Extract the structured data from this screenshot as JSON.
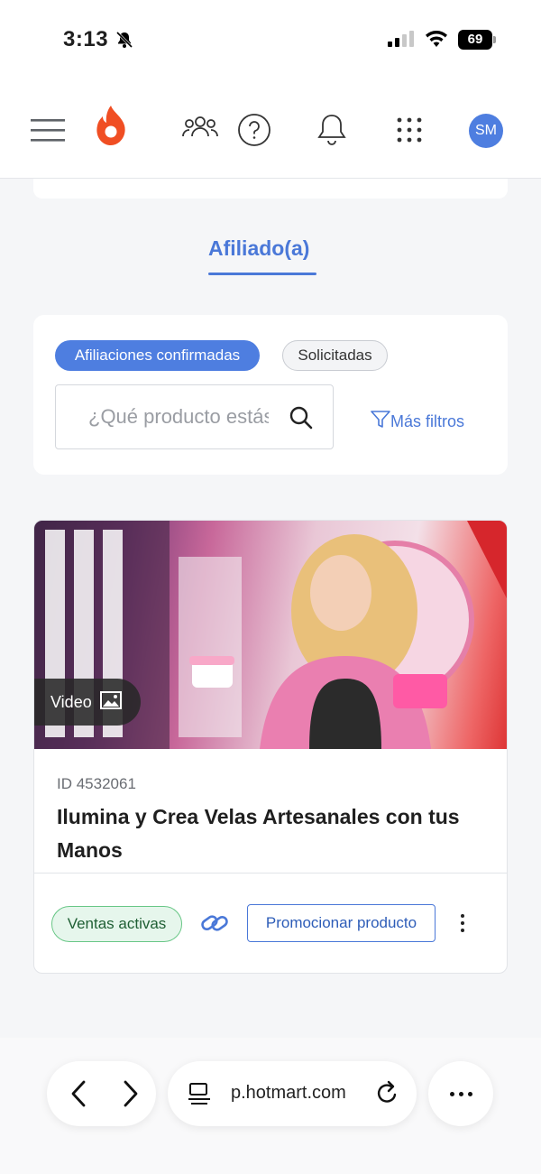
{
  "status_bar": {
    "time": "3:13",
    "battery": "69"
  },
  "header": {
    "avatar_initials": "SM",
    "brand_color": "#f04e23"
  },
  "tabs": {
    "active_label": "Afiliado(a)"
  },
  "filters": {
    "chip_active": "Afiliaciones confirmadas",
    "chip_inactive": "Solicitadas",
    "search_placeholder": "¿Qué producto estás buscando?",
    "more_filters": "Más filtros"
  },
  "product": {
    "media_badge": "Video",
    "id_text": "ID 4532061",
    "title": "Ilumina y Crea Velas Artesanales con tus Manos",
    "status": "Ventas activas",
    "promote_label": "Promocionar producto"
  },
  "browser": {
    "url": "p.hotmart.com"
  },
  "colors": {
    "accent": "#4e7ee0",
    "active_status": "#69c787"
  }
}
